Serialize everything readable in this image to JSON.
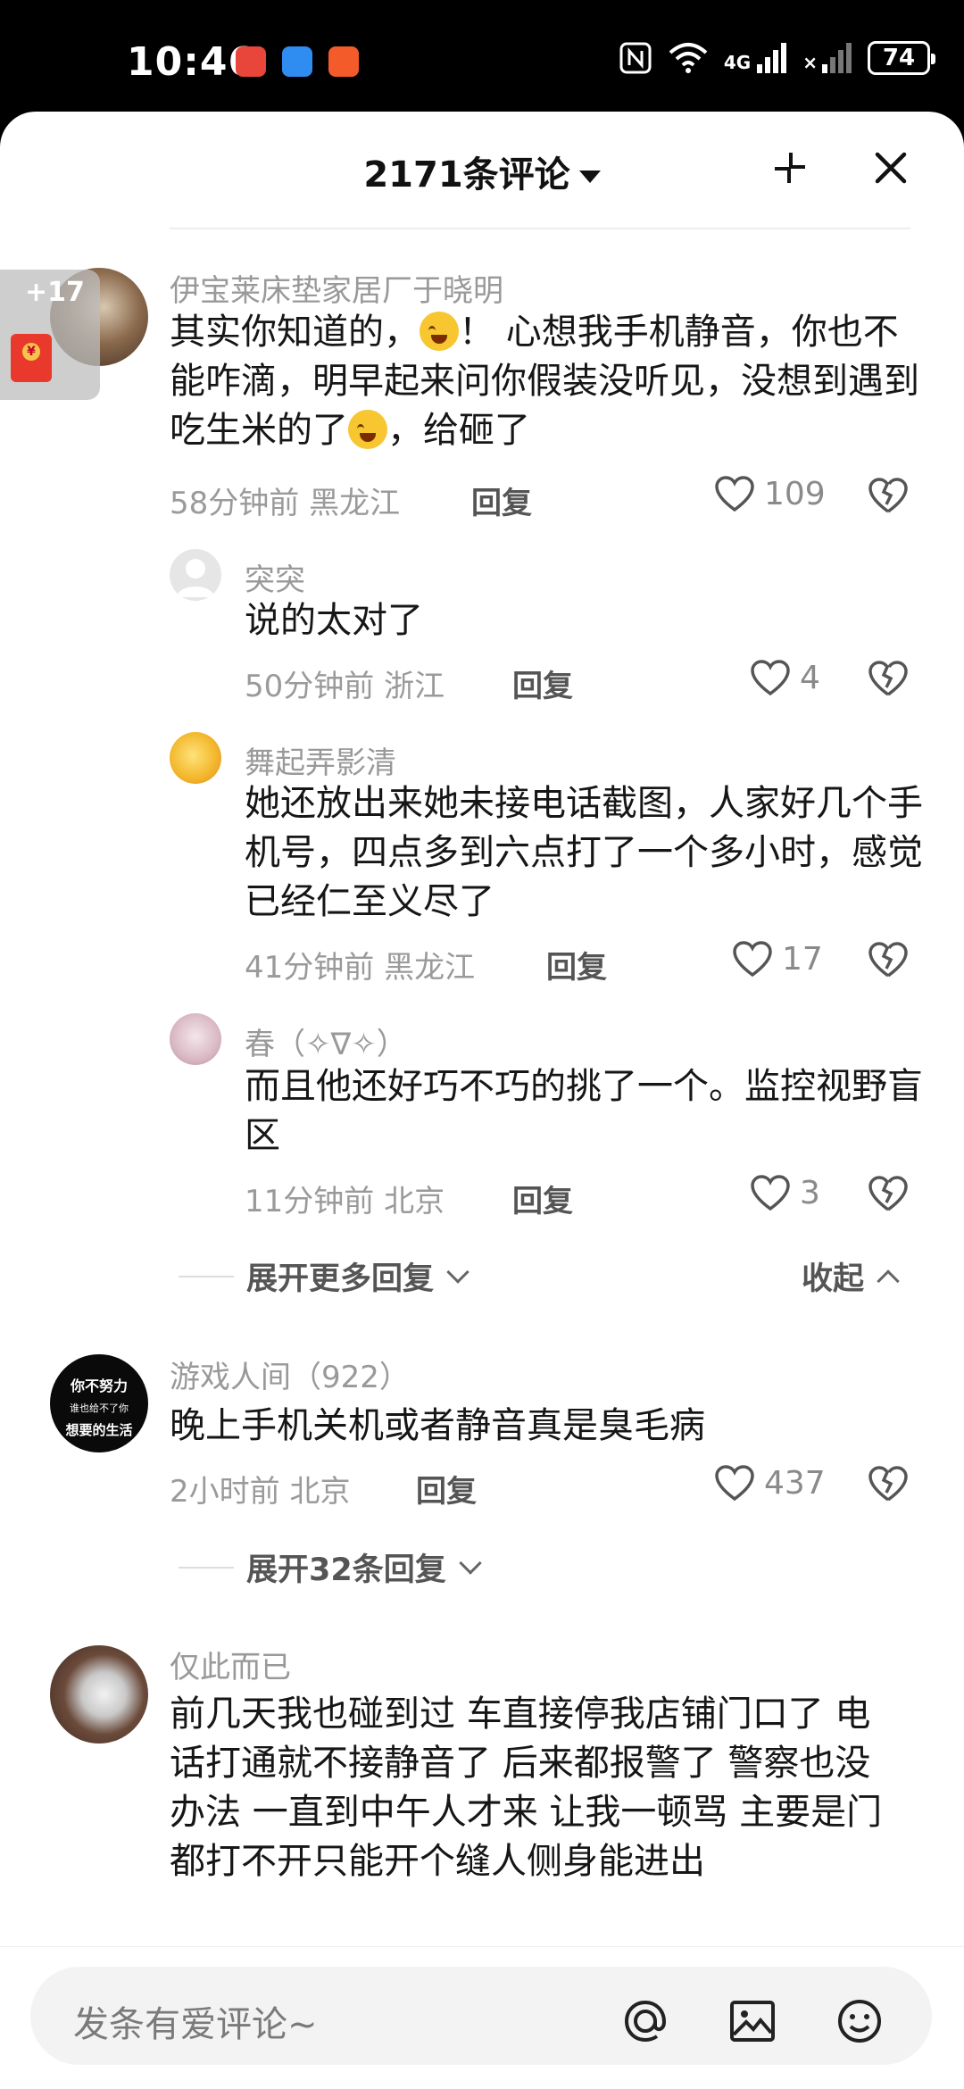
{
  "status_bar": {
    "time": "10:46",
    "network": "4G",
    "battery": "74"
  },
  "header": {
    "title": "2171条评论"
  },
  "red_packet": {
    "count": "+17"
  },
  "comments": [
    {
      "name": "伊宝莱床垫家居厂于晓明",
      "text_a": "其实你知道的，",
      "text_b": "！ 心想我手机静音，你也不能咋滴，明早起来问你假装没听见，没想到遇到吃生米的了",
      "text_c": "，给砸了",
      "time": "58分钟前",
      "location": "黑龙江",
      "reply": "回复",
      "likes": "109"
    },
    {
      "name": "突突",
      "text": "说的太对了",
      "time": "50分钟前",
      "location": "浙江",
      "reply": "回复",
      "likes": "4"
    },
    {
      "name": "舞起弄影清",
      "text": "她还放出来她未接电话截图，人家好几个手机号，四点多到六点打了一个多小时，感觉已经仁至义尽了",
      "time": "41分钟前",
      "location": "黑龙江",
      "reply": "回复",
      "likes": "17"
    },
    {
      "name": "春（✧∇✧）",
      "text": "而且他还好巧不巧的挑了一个。监控视野盲区",
      "time": "11分钟前",
      "location": "北京",
      "reply": "回复",
      "likes": "3"
    },
    {
      "name": "游戏人间（922）",
      "text": "晚上手机关机或者静音真是臭毛病",
      "time": "2小时前",
      "location": "北京",
      "reply": "回复",
      "likes": "437",
      "avatar_text": [
        "你不努力",
        "谁也给不了你",
        "想要的生活"
      ]
    },
    {
      "name": "仅此而已",
      "text": "前几天我也碰到过 车直接停我店铺门口了 电话打通就不接静音了 后来都报警了 警察也没办法 一直到中午人才来 让我一顿骂 主要是门都打不开只能开个缝人侧身能进出"
    }
  ],
  "expand_more": "展开更多回复",
  "collapse": "收起",
  "expand_32": "展开32条回复",
  "input_placeholder": "发条有爱评论~"
}
